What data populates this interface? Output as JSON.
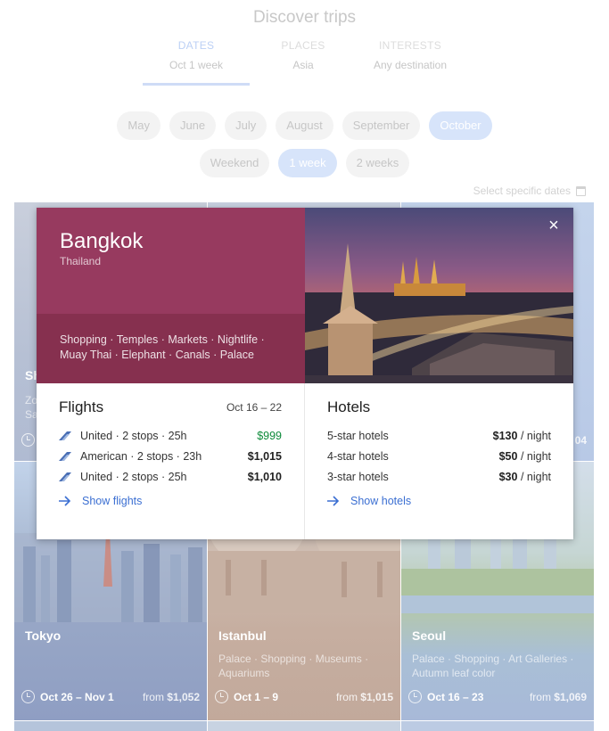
{
  "page": {
    "title": "Discover trips",
    "tabs": [
      {
        "name": "DATES",
        "value": "Oct 1 week"
      },
      {
        "name": "PLACES",
        "value": "Asia"
      },
      {
        "name": "INTERESTS",
        "value": "Any destination"
      }
    ],
    "months": [
      "May",
      "June",
      "July",
      "August",
      "September",
      "October"
    ],
    "durations": [
      "Weekend",
      "1 week",
      "2 weeks"
    ],
    "select_dates": "Select specific dates"
  },
  "cards": {
    "tokyo": {
      "city": "Tokyo",
      "dates": "Oct 26 – Nov 1",
      "from_label": "from",
      "price": "$1,052"
    },
    "istanbul": {
      "city": "Istanbul",
      "tags": "Palace · Shopping · Museums · Aquariums",
      "dates": "Oct 1 – 9",
      "from_label": "from",
      "price": "$1,015"
    },
    "seoul": {
      "city": "Seoul",
      "tags": "Palace · Shopping · Art Galleries · Autumn leaf color",
      "dates": "Oct 16 – 23",
      "from_label": "from",
      "price": "$1,069"
    },
    "partial_left": {
      "city": "Sh",
      "tags": "Zo Sa"
    },
    "partial_right": {
      "price_fragment": "04"
    }
  },
  "popup": {
    "city": "Bangkok",
    "country": "Thailand",
    "tags": "Shopping · Temples · Markets · Nightlife · Muay Thai · Elephant · Canals · Palace",
    "close_label": "×",
    "flights": {
      "title": "Flights",
      "dates": "Oct 16 – 22",
      "items": [
        {
          "desc": "United · 2 stops · 25h",
          "price": "$999"
        },
        {
          "desc": "American · 2 stops · 23h",
          "price": "$1,015"
        },
        {
          "desc": "United · 2 stops · 25h",
          "price": "$1,010"
        }
      ],
      "link": "Show flights"
    },
    "hotels": {
      "title": "Hotels",
      "items": [
        {
          "desc": "5-star hotels",
          "price": "$130",
          "unit": "/ night"
        },
        {
          "desc": "4-star hotels",
          "price": "$50",
          "unit": "/ night"
        },
        {
          "desc": "3-star hotels",
          "price": "$30",
          "unit": "/ night"
        }
      ],
      "link": "Show hotels"
    }
  },
  "colors": {
    "accent_blue": "#3b6fd2",
    "cheap_green": "#0d8a3a",
    "hero_magenta": "#973a5f"
  }
}
